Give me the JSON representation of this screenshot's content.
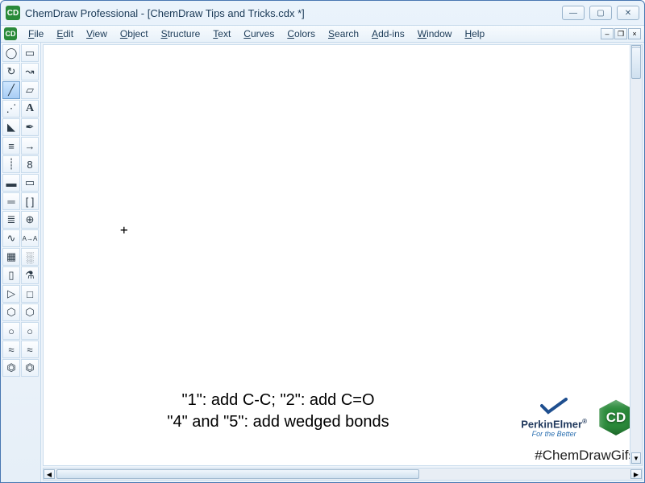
{
  "title": "ChemDraw Professional - [ChemDraw Tips and Tricks.cdx *]",
  "app_icon_glyph": "CD",
  "win_controls": {
    "min": "—",
    "max": "▢",
    "close": "✕"
  },
  "menu": [
    "File",
    "Edit",
    "View",
    "Object",
    "Structure",
    "Text",
    "Curves",
    "Colors",
    "Search",
    "Add-ins",
    "Window",
    "Help"
  ],
  "mdi": {
    "min": "–",
    "max": "❐",
    "close": "×"
  },
  "tip_line1": "\"1\": add C-C; \"2\": add C=O",
  "tip_line2": "\"4\" and \"5\": add wedged bonds",
  "brand": {
    "name": "PerkinElmer",
    "tagline": "For the Better",
    "reg": "®"
  },
  "cd_badge": "CD",
  "hashtag": "#ChemDrawGifs",
  "tool_glyphs": {
    "lasso": "◯",
    "marquee": "▭",
    "rotate": "↻",
    "erase_curve": "↝",
    "bond": "╱",
    "erase": "▱",
    "dash_bond": "⋰",
    "text": "A",
    "wedge": "◣",
    "pen": "✒",
    "hash": "≡",
    "arrow": "→",
    "dots": "┊",
    "orbit": "8",
    "bold": "▬",
    "frame": "▭",
    "dbl": "═",
    "bracket": "[ ]",
    "triple": "≣",
    "plus": "⊕",
    "wavy": "∿",
    "a2a": "A→A",
    "table": "▦",
    "grid": "░",
    "tlc": "▯",
    "flask": "⚗",
    "play": "▷",
    "rect": "□",
    "hex1": "⬡",
    "hex2": "⬡",
    "circ1": "○",
    "circ2": "○",
    "dwave": "≈",
    "swave": "≈",
    "benz1": "⏣",
    "benz2": "⏣"
  }
}
